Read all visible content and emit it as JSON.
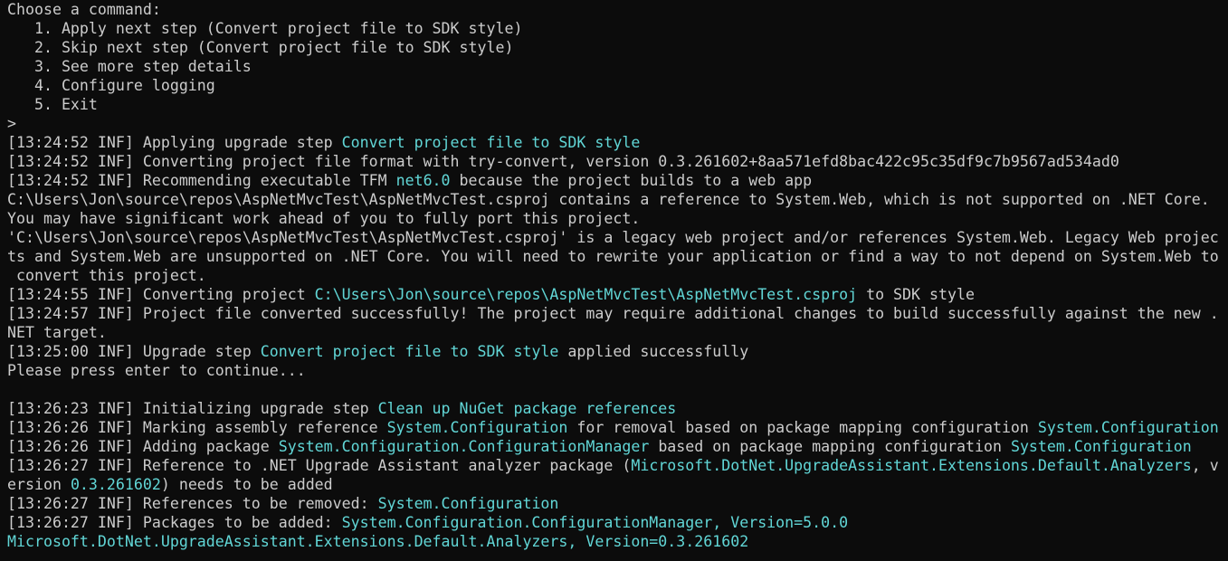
{
  "theme": {
    "background": "#0c0c0c",
    "text": "#cccccc",
    "highlight": "#61d6d6"
  },
  "lines": [
    [
      {
        "t": "Choose a command:"
      }
    ],
    [
      {
        "t": "   1. Apply next step (Convert project file to SDK style)"
      }
    ],
    [
      {
        "t": "   2. Skip next step (Convert project file to SDK style)"
      }
    ],
    [
      {
        "t": "   3. See more step details"
      }
    ],
    [
      {
        "t": "   4. Configure logging"
      }
    ],
    [
      {
        "t": "   5. Exit"
      }
    ],
    [
      {
        "t": ">"
      }
    ],
    [
      {
        "t": "[13:24:52 INF] Applying upgrade step "
      },
      {
        "t": "Convert project file to SDK style",
        "h": true
      }
    ],
    [
      {
        "t": "[13:24:52 INF] Converting project file format with try-convert, version 0.3.261602+8aa571efd8bac422c95c35df9c7b9567ad534ad0"
      }
    ],
    [
      {
        "t": "[13:24:52 INF] Recommending executable TFM "
      },
      {
        "t": "net6.0",
        "h": true
      },
      {
        "t": " because the project builds to a web app"
      }
    ],
    [
      {
        "t": "C:\\Users\\Jon\\source\\repos\\AspNetMvcTest\\AspNetMvcTest.csproj contains a reference to System.Web, which is not supported on .NET Core."
      }
    ],
    [
      {
        "t": "You may have significant work ahead of you to fully port this project."
      }
    ],
    [
      {
        "t": "'C:\\Users\\Jon\\source\\repos\\AspNetMvcTest\\AspNetMvcTest.csproj' is a legacy web project and/or references System.Web. Legacy Web projec"
      }
    ],
    [
      {
        "t": "ts and System.Web are unsupported on .NET Core. You will need to rewrite your application or find a way to not depend on System.Web to"
      }
    ],
    [
      {
        "t": " convert this project."
      }
    ],
    [
      {
        "t": "[13:24:55 INF] Converting project "
      },
      {
        "t": "C:\\Users\\Jon\\source\\repos\\AspNetMvcTest\\AspNetMvcTest.csproj",
        "h": true
      },
      {
        "t": " to SDK style"
      }
    ],
    [
      {
        "t": "[13:24:57 INF] Project file converted successfully! The project may require additional changes to build successfully against the new ."
      }
    ],
    [
      {
        "t": "NET target."
      }
    ],
    [
      {
        "t": "[13:25:00 INF] Upgrade step "
      },
      {
        "t": "Convert project file to SDK style",
        "h": true
      },
      {
        "t": " applied successfully"
      }
    ],
    [
      {
        "t": "Please press enter to continue..."
      }
    ],
    [
      {
        "t": ""
      }
    ],
    [
      {
        "t": "[13:26:23 INF] Initializing upgrade step "
      },
      {
        "t": "Clean up NuGet package references",
        "h": true
      }
    ],
    [
      {
        "t": "[13:26:26 INF] Marking assembly reference "
      },
      {
        "t": "System.Configuration",
        "h": true
      },
      {
        "t": " for removal based on package mapping configuration "
      },
      {
        "t": "System.Configuration",
        "h": true
      }
    ],
    [
      {
        "t": "[13:26:26 INF] Adding package "
      },
      {
        "t": "System.Configuration.ConfigurationManager",
        "h": true
      },
      {
        "t": " based on package mapping configuration "
      },
      {
        "t": "System.Configuration",
        "h": true
      }
    ],
    [
      {
        "t": "[13:26:27 INF] Reference to .NET Upgrade Assistant analyzer package ("
      },
      {
        "t": "Microsoft.DotNet.UpgradeAssistant.Extensions.Default.Analyzers",
        "h": true
      },
      {
        "t": ", v"
      }
    ],
    [
      {
        "t": "ersion "
      },
      {
        "t": "0.3.261602",
        "h": true
      },
      {
        "t": ") needs to be added"
      }
    ],
    [
      {
        "t": "[13:26:27 INF] References to be removed: "
      },
      {
        "t": "System.Configuration",
        "h": true
      }
    ],
    [
      {
        "t": "[13:26:27 INF] Packages to be added: "
      },
      {
        "t": "System.Configuration.ConfigurationManager, Version=5.0.0",
        "h": true
      }
    ],
    [
      {
        "t": "Microsoft.DotNet.UpgradeAssistant.Extensions.Default.Analyzers, Version=0.3.261602",
        "h": true
      }
    ]
  ]
}
